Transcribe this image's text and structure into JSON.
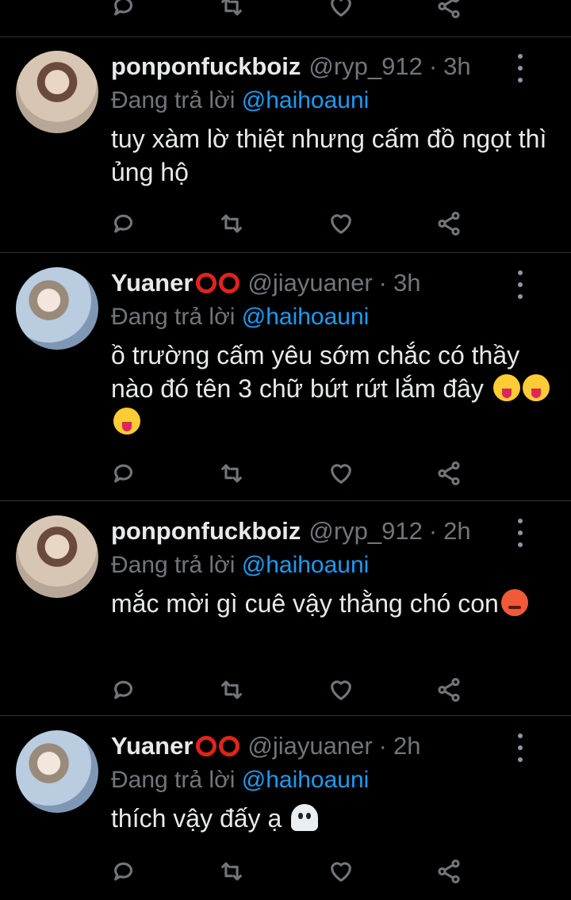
{
  "mention_prefix": "Đang trả lời",
  "tweets": [
    {
      "name": "ponponfuckboiz",
      "handle": "@ryp_912",
      "separator": "·",
      "time": "3h",
      "reply_to": "@haihoauni",
      "text": "tuy xàm lờ thiệt nhưng cấm đồ ngọt thì ủng hộ"
    },
    {
      "name": "Yuaner",
      "handle": "@jiayuaner",
      "separator": "·",
      "time": "3h",
      "reply_to": "@haihoauni",
      "text": "ồ trường cấm yêu sớm chắc có thầy nào đó tên 3 chữ bứt rứt lắm đây"
    },
    {
      "name": "ponponfuckboiz",
      "handle": "@ryp_912",
      "separator": "·",
      "time": "2h",
      "reply_to": "@haihoauni",
      "text": "mắc mời gì cuê vậy thằng chó con"
    },
    {
      "name": "Yuaner",
      "handle": "@jiayuaner",
      "separator": "·",
      "time": "2h",
      "reply_to": "@haihoauni",
      "text": "thích vậy đấy ạ"
    }
  ],
  "icons": [
    "reply-icon",
    "retweet-icon",
    "like-icon",
    "share-icon",
    "more-icon"
  ],
  "colors": {
    "background": "#000000",
    "link": "#1d9bf0",
    "muted": "#71767b",
    "ring": "#e0241b"
  }
}
